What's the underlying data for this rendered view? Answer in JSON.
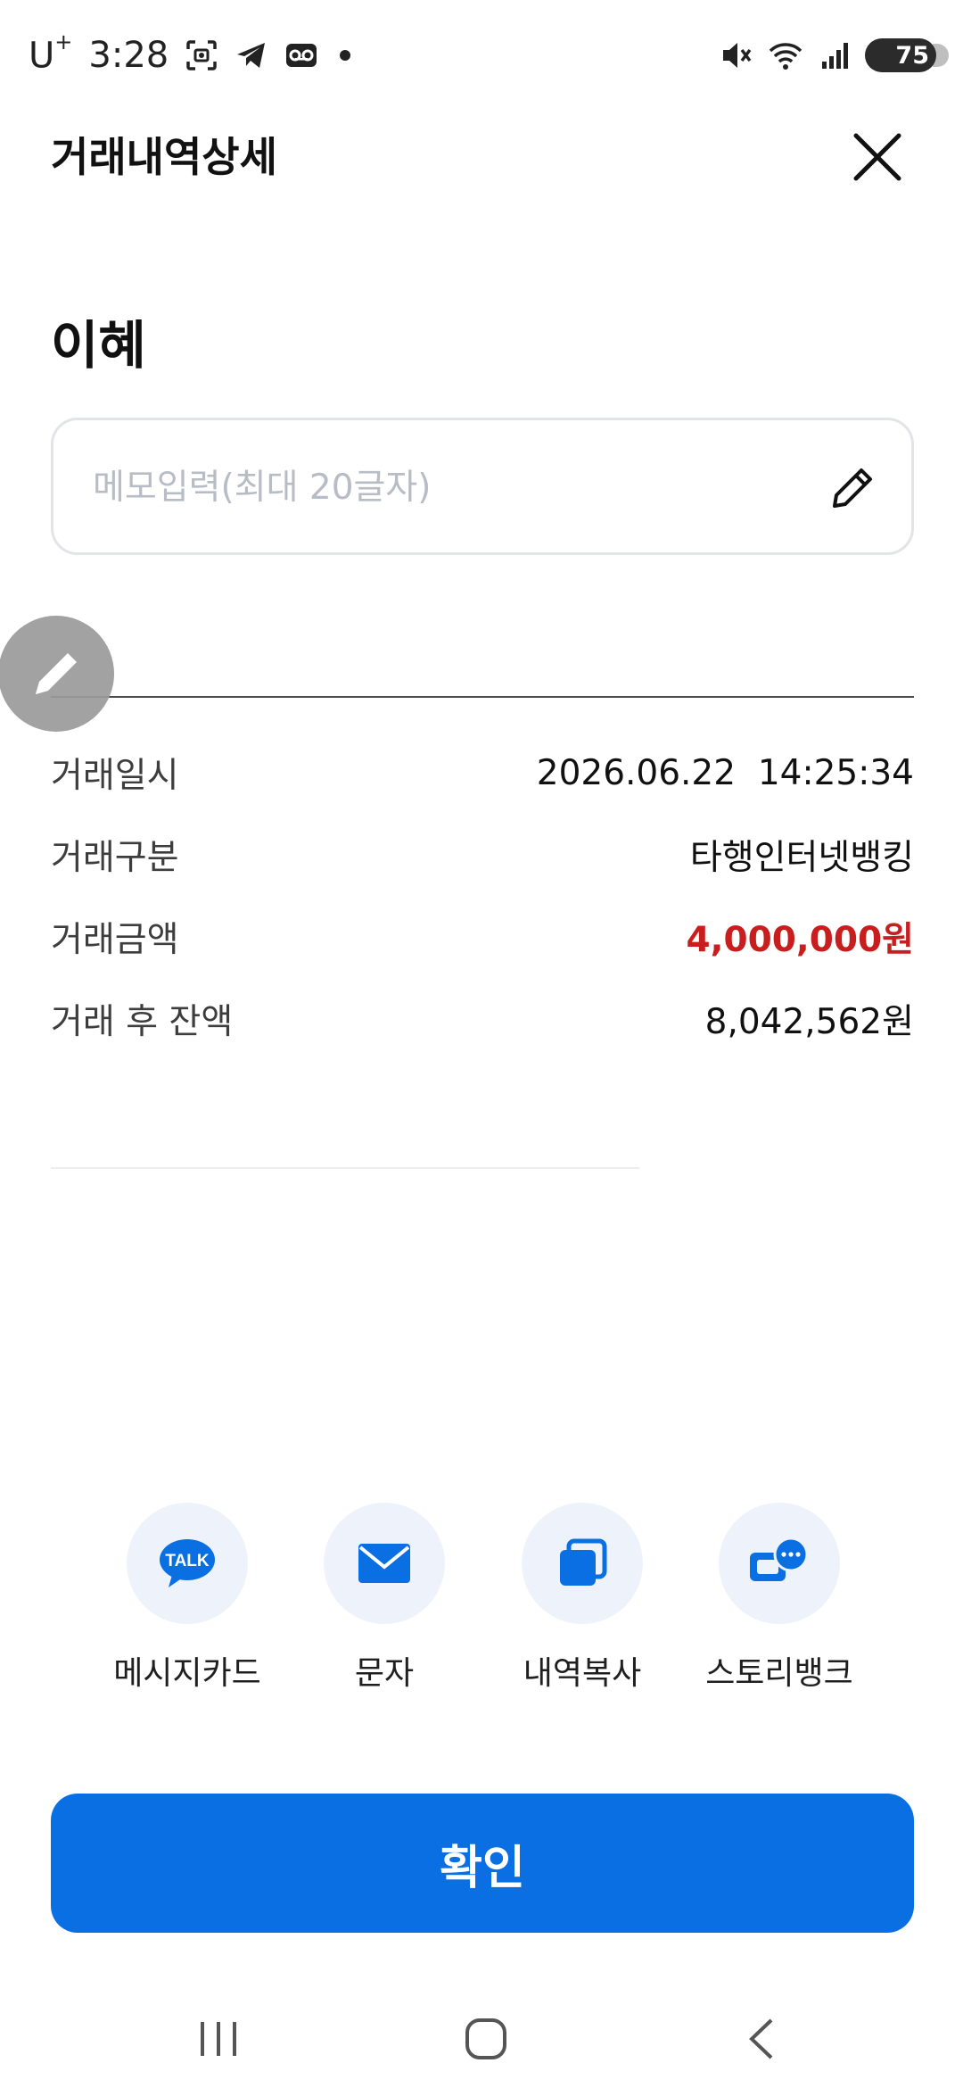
{
  "status_bar": {
    "carrier": "U",
    "carrier_sup": "+",
    "time": "3:28",
    "battery": "75"
  },
  "header": {
    "title": "거래내역상세"
  },
  "payee": "이혜",
  "memo": {
    "placeholder": "메모입력(최대 20글자)",
    "value": ""
  },
  "details": [
    {
      "label": "거래일시",
      "value": "2026.06.22  14:25:34"
    },
    {
      "label": "거래구분",
      "value": "타행인터넷뱅킹"
    },
    {
      "label": "거래금액",
      "value": "4,000,000원"
    },
    {
      "label": "거래 후 잔액",
      "value": "8,042,562원"
    }
  ],
  "share": [
    {
      "label": "메시지카드",
      "icon": "kakaotalk-icon",
      "icon_text": "TALK"
    },
    {
      "label": "문자",
      "icon": "mail-icon"
    },
    {
      "label": "내역복사",
      "icon": "copy-icon"
    },
    {
      "label": "스토리뱅크",
      "icon": "chat-bubbles-icon"
    }
  ],
  "confirm_label": "확인",
  "colors": {
    "accent": "#0a6fe3",
    "amount": "#c81e1e",
    "share_bg": "#eef3fb"
  }
}
